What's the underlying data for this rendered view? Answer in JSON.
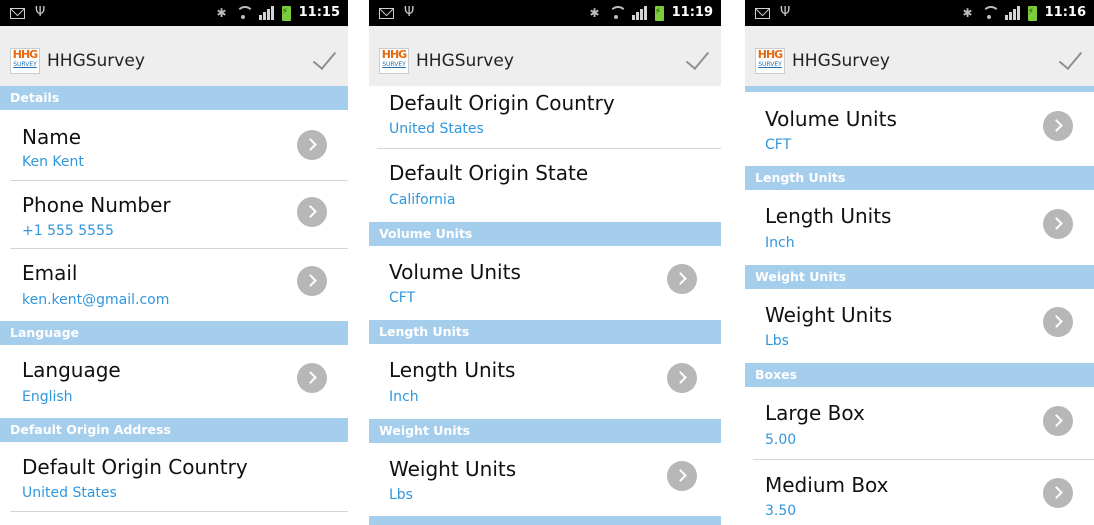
{
  "app": {
    "title": "HHGSurvey",
    "logo_top": "HHG",
    "logo_bottom": "SURVEY"
  },
  "screens": [
    {
      "time": "11:15",
      "sections": {
        "details": "Details",
        "language": "Language",
        "origin": "Default Origin Address"
      },
      "items": {
        "name": {
          "label": "Name",
          "value": "Ken Kent"
        },
        "phone": {
          "label": "Phone Number",
          "value": "+1 555 5555"
        },
        "email": {
          "label": "Email",
          "value": "ken.kent@gmail.com"
        },
        "language": {
          "label": "Language",
          "value": "English"
        },
        "origin_country": {
          "label": "Default Origin Country",
          "value": "United States"
        }
      }
    },
    {
      "time": "11:19",
      "sections": {
        "volume": "Volume Units",
        "length": "Length Units",
        "weight": "Weight Units"
      },
      "items": {
        "origin_country": {
          "label": "Default Origin Country",
          "value": "United States"
        },
        "origin_state": {
          "label": "Default Origin State",
          "value": "California"
        },
        "volume": {
          "label": "Volume Units",
          "value": "CFT"
        },
        "length": {
          "label": "Length Units",
          "value": "Inch"
        },
        "weight": {
          "label": "Weight Units",
          "value": "Lbs"
        }
      }
    },
    {
      "time": "11:16",
      "sections": {
        "length": "Length Units",
        "weight": "Weight Units",
        "boxes": "Boxes"
      },
      "items": {
        "volume": {
          "label": "Volume Units",
          "value": "CFT"
        },
        "length": {
          "label": "Length Units",
          "value": "Inch"
        },
        "weight": {
          "label": "Weight Units",
          "value": "Lbs"
        },
        "large_box": {
          "label": "Large Box",
          "value": "5.00"
        },
        "medium_box": {
          "label": "Medium Box",
          "value": "3.50"
        }
      }
    }
  ]
}
